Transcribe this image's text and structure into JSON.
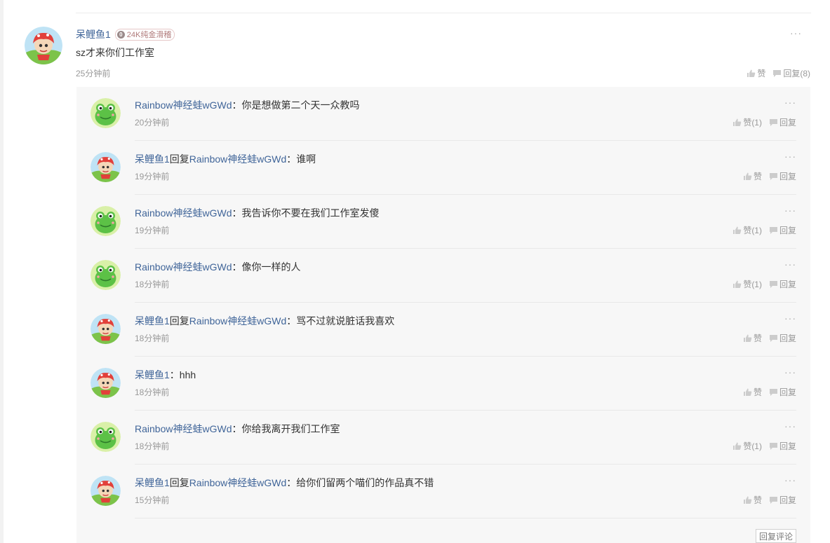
{
  "main": {
    "author": "呆鲤鱼1",
    "badge_level": "0",
    "badge_text": "24K纯金滑稽",
    "content": "sz才来你们工作室",
    "time": "25分钟前",
    "like_label": "赞",
    "reply_label": "回复(8)",
    "more": "···"
  },
  "replies": [
    {
      "avatar": "frog",
      "author": "Rainbow神经蛙wGWd",
      "reply_word": "",
      "target": "",
      "text": "：你是想做第二个天一众教吗",
      "time": "20分钟前",
      "like_label": "赞(1)",
      "reply_label": "回复",
      "more": "···"
    },
    {
      "avatar": "fish",
      "author": "呆鲤鱼1",
      "reply_word": "回复",
      "target": "Rainbow神经蛙wGWd",
      "text": "：谁啊",
      "time": "19分钟前",
      "like_label": "赞",
      "reply_label": "回复",
      "more": "···"
    },
    {
      "avatar": "frog",
      "author": "Rainbow神经蛙wGWd",
      "reply_word": "",
      "target": "",
      "text": "：我告诉你不要在我们工作室发傻",
      "time": "19分钟前",
      "like_label": "赞(1)",
      "reply_label": "回复",
      "more": "···"
    },
    {
      "avatar": "frog",
      "author": "Rainbow神经蛙wGWd",
      "reply_word": "",
      "target": "",
      "text": "：像你一样的人",
      "time": "18分钟前",
      "like_label": "赞(1)",
      "reply_label": "回复",
      "more": "···"
    },
    {
      "avatar": "fish",
      "author": "呆鲤鱼1",
      "reply_word": "回复",
      "target": "Rainbow神经蛙wGWd",
      "text": "：骂不过就说脏话我喜欢",
      "time": "18分钟前",
      "like_label": "赞",
      "reply_label": "回复",
      "more": "···"
    },
    {
      "avatar": "fish",
      "author": "呆鲤鱼1",
      "reply_word": "",
      "target": "",
      "text": "：hhh",
      "time": "18分钟前",
      "like_label": "赞",
      "reply_label": "回复",
      "more": "···"
    },
    {
      "avatar": "frog",
      "author": "Rainbow神经蛙wGWd",
      "reply_word": "",
      "target": "",
      "text": "：你给我离开我们工作室",
      "time": "18分钟前",
      "like_label": "赞(1)",
      "reply_label": "回复",
      "more": "···"
    },
    {
      "avatar": "fish",
      "author": "呆鲤鱼1",
      "reply_word": "回复",
      "target": "Rainbow神经蛙wGWd",
      "text": "：给你们留两个喵们的作品真不错",
      "time": "15分钟前",
      "like_label": "赞",
      "reply_label": "回复",
      "more": "···"
    }
  ],
  "reply_comment_button": "回复评论",
  "colors": {
    "name": "#406599",
    "box_bg": "#f7f7f7",
    "meta": "#999999"
  }
}
